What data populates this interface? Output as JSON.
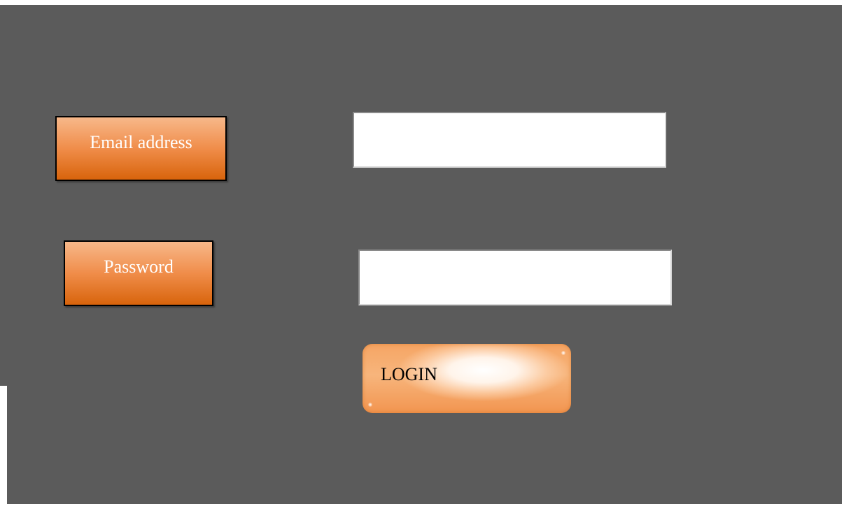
{
  "form": {
    "email_label": "Email address",
    "email_value": "",
    "password_label": "Password",
    "password_value": "",
    "login_label": "LOGIN"
  },
  "colors": {
    "background": "#5b5b5b",
    "label_orange_top": "#f7b88a",
    "label_orange_bottom": "#d8640c",
    "label_text": "#ffffff",
    "button_orange": "#f6a564",
    "field_background": "#ffffff"
  }
}
